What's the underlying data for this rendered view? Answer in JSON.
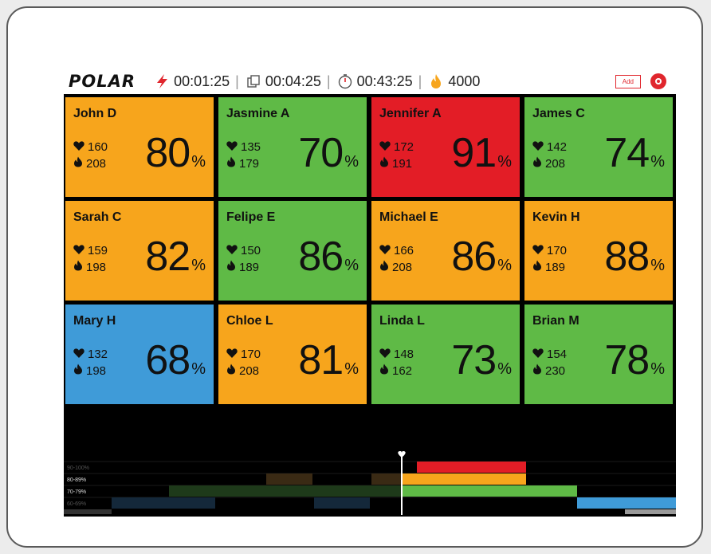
{
  "header": {
    "logo": "POLAR",
    "time_a": "00:01:25",
    "time_b": "00:04:25",
    "time_c": "00:43:25",
    "calories": "4000",
    "add_label": "Add"
  },
  "colors": {
    "orange": "#f7a51c",
    "green": "#5fba46",
    "red": "#e31d26",
    "blue": "#3f9bd8"
  },
  "athletes": [
    {
      "name": "John D",
      "hr": "160",
      "cal": "208",
      "pct": "80",
      "unit": "%",
      "zone": "orange"
    },
    {
      "name": "Jasmine A",
      "hr": "135",
      "cal": "179",
      "pct": "70",
      "unit": "%",
      "zone": "green"
    },
    {
      "name": "Jennifer A",
      "hr": "172",
      "cal": "191",
      "pct": "91",
      "unit": "%",
      "zone": "red"
    },
    {
      "name": "James C",
      "hr": "142",
      "cal": "208",
      "pct": "74",
      "unit": "%",
      "zone": "green"
    },
    {
      "name": "Sarah C",
      "hr": "159",
      "cal": "198",
      "pct": "82",
      "unit": "%",
      "zone": "orange"
    },
    {
      "name": "Felipe E",
      "hr": "150",
      "cal": "189",
      "pct": "86",
      "unit": "%",
      "zone": "green"
    },
    {
      "name": "Michael E",
      "hr": "166",
      "cal": "208",
      "pct": "86",
      "unit": "%",
      "zone": "orange"
    },
    {
      "name": "Kevin H",
      "hr": "170",
      "cal": "189",
      "pct": "88",
      "unit": "%",
      "zone": "orange"
    },
    {
      "name": "Mary H",
      "hr": "132",
      "cal": "198",
      "pct": "68",
      "unit": "%",
      "zone": "blue"
    },
    {
      "name": "Chloe L",
      "hr": "170",
      "cal": "208",
      "pct": "81",
      "unit": "%",
      "zone": "orange"
    },
    {
      "name": "Linda L",
      "hr": "148",
      "cal": "162",
      "pct": "73",
      "unit": "%",
      "zone": "green"
    },
    {
      "name": "Brian M",
      "hr": "154",
      "cal": "230",
      "pct": "78",
      "unit": "%",
      "zone": "green"
    }
  ],
  "timeline": {
    "lanes": [
      "90-100%",
      "80-89%",
      "70-79%",
      "60-69%"
    ]
  }
}
